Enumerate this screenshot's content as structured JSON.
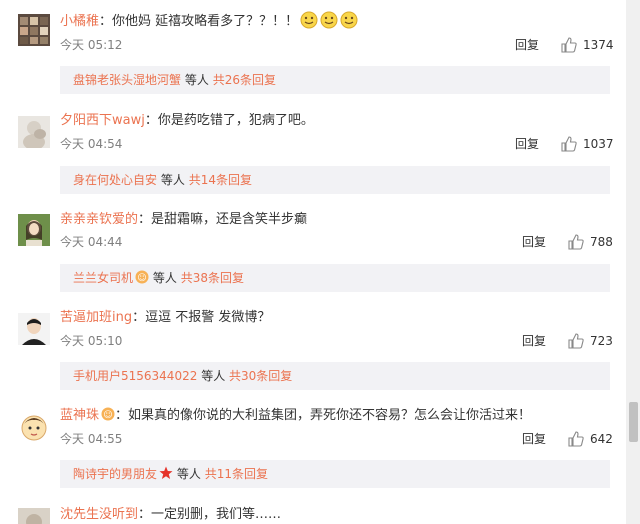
{
  "comments": [
    {
      "username": "小橘稚",
      "text": "：你他妈 延禧攻略看多了？？！！",
      "time": "今天 05:12",
      "reply": "回复",
      "likes": "1374",
      "sub": {
        "user": "盘锦老张头湿地河蟹",
        "people": "等人",
        "count": "共26条回复"
      },
      "emoji": [
        "smile-emoji",
        "smile-emoji",
        "smile-emoji"
      ]
    },
    {
      "username": "夕阳西下wawj",
      "text": "：你是药吃错了，犯病了吧。",
      "time": "今天 04:54",
      "reply": "回复",
      "likes": "1037",
      "sub": {
        "user": "身在何处心自安",
        "people": "等人",
        "count": "共14条回复"
      }
    },
    {
      "username": "亲亲亲钦爱的",
      "text": "：是甜霜嘛，还是含笑半步癫",
      "time": "今天 04:44",
      "reply": "回复",
      "likes": "788",
      "sub": {
        "user": "兰兰女司机",
        "people": "等人",
        "count": "共38条回复",
        "badge": "vip-badge-icon"
      }
    },
    {
      "username": "苦逼加班ing",
      "text": "：逗逗 不报警 发微博？",
      "time": "今天 05:10",
      "reply": "回复",
      "likes": "723",
      "sub": {
        "user": "手机用户5156344022",
        "people": "等人",
        "count": "共30条回复"
      }
    },
    {
      "username": "蓝神珠",
      "text": "：如果真的像你说的大利益集团，弄死你还不容易？怎么会让你活过来！",
      "time": "今天 04:55",
      "reply": "回复",
      "likes": "642",
      "sub": {
        "user": "陶诗宇的男朋友",
        "people": "等人",
        "count": "共11条回复",
        "badge": "red-star-icon"
      },
      "badge": "vip-badge-icon"
    },
    {
      "username": "沈先生没听到",
      "text": "：一定别删，我们等……"
    }
  ],
  "colors": {
    "username": "#eb7350",
    "subbox_bg": "#f2f2f5",
    "time": "#808080"
  }
}
